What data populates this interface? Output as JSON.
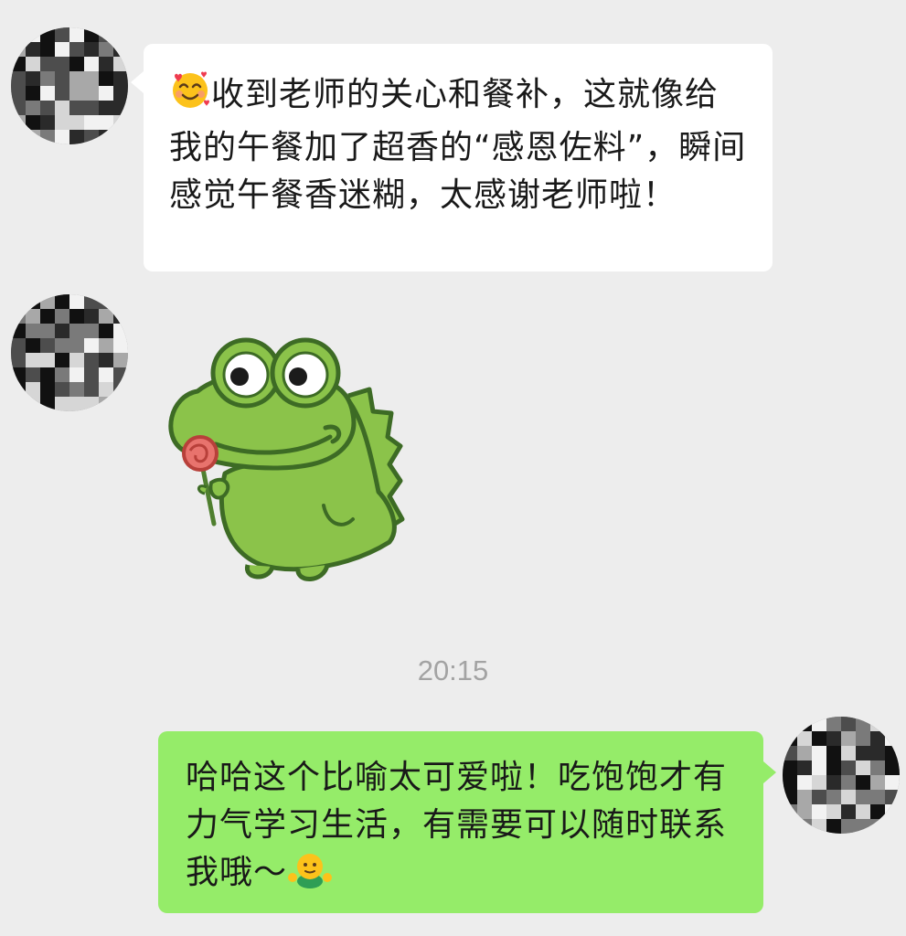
{
  "messages": [
    {
      "direction": "incoming",
      "type": "text",
      "emoji": "smiling-face-with-hearts-emoji",
      "text": "收到老师的关心和餐补，这就像给我的午餐加了超香的“感恩佐料”，瞬间感觉午餐香迷糊，太感谢老师啦！"
    },
    {
      "direction": "incoming",
      "type": "sticker",
      "sticker": "green-dinosaur-holding-rose-sticker"
    },
    {
      "direction": "outgoing",
      "type": "text",
      "text": "哈哈这个比喻太可爱啦！吃饱饱才有力气学习生活，有需要可以随时联系我哦～",
      "emoji": "hugging-face-emoji"
    }
  ],
  "timestamp": "20:15",
  "colors": {
    "background": "#ededed",
    "incoming_bubble": "#ffffff",
    "outgoing_bubble": "#95ec69",
    "timestamp_text": "#a3a3a3",
    "message_text": "#191919"
  }
}
